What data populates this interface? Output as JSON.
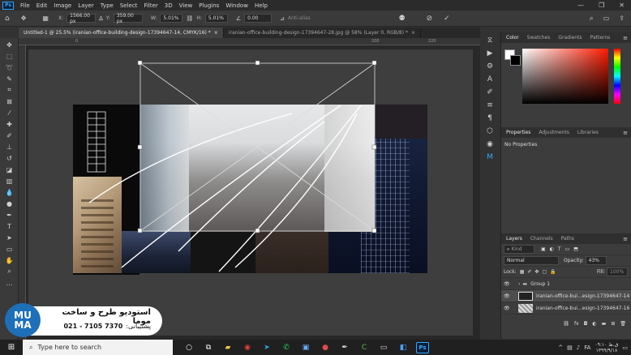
{
  "menubar": {
    "app_logo": "Ps",
    "items": [
      "File",
      "Edit",
      "Image",
      "Layer",
      "Type",
      "Select",
      "Filter",
      "3D",
      "View",
      "Plugins",
      "Window",
      "Help"
    ],
    "window_buttons": [
      "—",
      "❐",
      "✕"
    ]
  },
  "options": {
    "x_label": "X:",
    "x_value": "1566.00 px",
    "y_label": "Y:",
    "y_value": "359.00 px",
    "w_label": "W:",
    "w_value": "5.01%",
    "h_label": "H:",
    "h_value": "5.01%",
    "angle_value": "0.00",
    "antialias": "Anti-alias"
  },
  "tabs": [
    {
      "label": "Untitled-1 @ 25.5% (iranian-office-building-design-17394647-14, CMYK/16) *",
      "close": "×"
    },
    {
      "label": "iranian-office-building-design-17394647-28.jpg @ 58% (Layer 0, RGB/8) *",
      "close": "×"
    }
  ],
  "ruler": {
    "ticks": [
      "0",
      "10",
      "20",
      "30",
      "40",
      "50",
      "60",
      "70",
      "80",
      "90",
      "100",
      "110",
      "120",
      "130",
      "140",
      "150",
      "160",
      "170",
      "180",
      "190",
      "200",
      "210",
      "220"
    ]
  },
  "color_panel": {
    "tabs": [
      "Color",
      "Swatches",
      "Gradients",
      "Patterns"
    ]
  },
  "properties_panel": {
    "tabs": [
      "Properties",
      "Adjustments",
      "Libraries"
    ],
    "empty_text": "No Properties"
  },
  "layers_panel": {
    "tabs": [
      "Layers",
      "Channels",
      "Paths"
    ],
    "kind_placeholder": "Kind",
    "blend_mode": "Normal",
    "opacity_label": "Opacity:",
    "opacity_value": "43%",
    "lock_label": "Lock:",
    "fill_label": "Fill:",
    "fill_value": "100%",
    "layers": [
      {
        "name": "Group 1",
        "type": "group"
      },
      {
        "name": "iranian-office-bui...esign-17394647-14",
        "type": "image",
        "selected": true
      },
      {
        "name": "iranian-office-bui...esign-17394647-16",
        "type": "image",
        "selected": false
      }
    ]
  },
  "watermark": {
    "logo_top": "MU",
    "logo_bottom": "MA",
    "title": "استودیو طرح و ساخت موما",
    "support_label": "پشتیبانی:",
    "phone": "021 - 7105 7370"
  },
  "taskbar": {
    "search_placeholder": "Type here to search",
    "clock_time": "ق.ظ ۰۹:۱۰",
    "clock_date": "۱۳۹۹/۹/۱۸",
    "lang": "FA"
  },
  "colors": {
    "accent": "#31a8ff",
    "panel": "#3c3c3c",
    "canvas_bg": "#282828",
    "watermark_blue": "#1d6fb8"
  }
}
